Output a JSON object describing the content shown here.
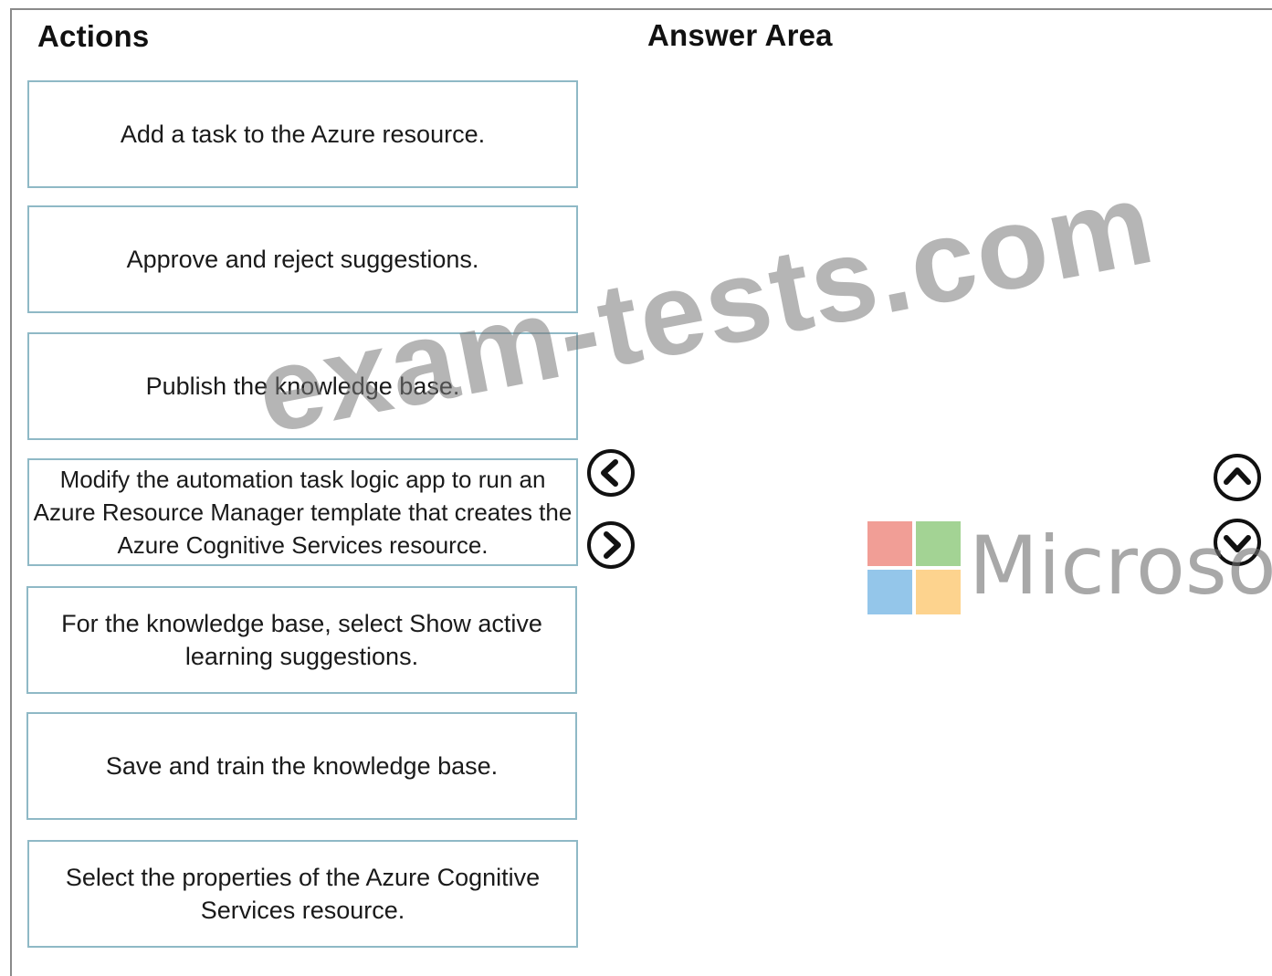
{
  "headings": {
    "actions": "Actions",
    "answer_area": "Answer Area"
  },
  "actions": [
    "Add a task to the Azure resource.",
    "Approve and reject suggestions.",
    "Publish the knowledge base.",
    "Modify the automation task logic app to run an Azure Resource Manager template that creates the Azure Cognitive Services resource.",
    "For the knowledge base, select Show active learning suggestions.",
    "Save and train the knowledge base.",
    "Select the properties of the Azure Cognitive Services resource."
  ],
  "controls": {
    "move_left_icon": "chevron-left-icon",
    "move_right_icon": "chevron-right-icon",
    "move_up_icon": "chevron-up-icon",
    "move_down_icon": "chevron-down-icon"
  },
  "watermark": {
    "text": "exam-tests.com",
    "brand": "Microsoft",
    "logo_colors": [
      "#f19e96",
      "#a3d394",
      "#94c6ea",
      "#fdd38e"
    ]
  }
}
